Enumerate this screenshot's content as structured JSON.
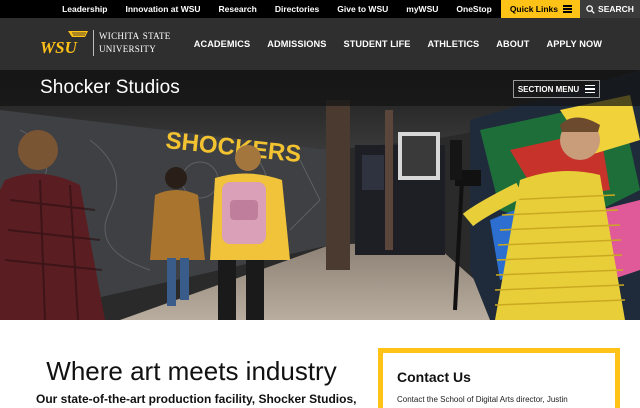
{
  "utility_nav": {
    "links": [
      "Leadership",
      "Innovation at WSU",
      "Research",
      "Directories",
      "Give to WSU",
      "myWSU",
      "OneStop"
    ],
    "quick_links": "Quick Links",
    "search": "SEARCH"
  },
  "header": {
    "logo_text": "WSU",
    "university_line1": "Wichita State",
    "university_line2": "University",
    "nav": [
      "ACADEMICS",
      "ADMISSIONS",
      "STUDENT LIFE",
      "ATHLETICS",
      "ABOUT",
      "APPLY NOW"
    ]
  },
  "hero": {
    "title": "Shocker Studios",
    "section_menu": "SECTION MENU",
    "wall_text": "SHOCKERS"
  },
  "main": {
    "heading": "Where art meets industry",
    "intro": "Our state-of-the-art production facility, Shocker Studios,"
  },
  "contact": {
    "title": "Contact Us",
    "text": "Contact the School of Digital Arts director, Justin"
  },
  "colors": {
    "gold": "#ffc217",
    "black": "#000000",
    "nav_bg": "#2f2f2f"
  }
}
